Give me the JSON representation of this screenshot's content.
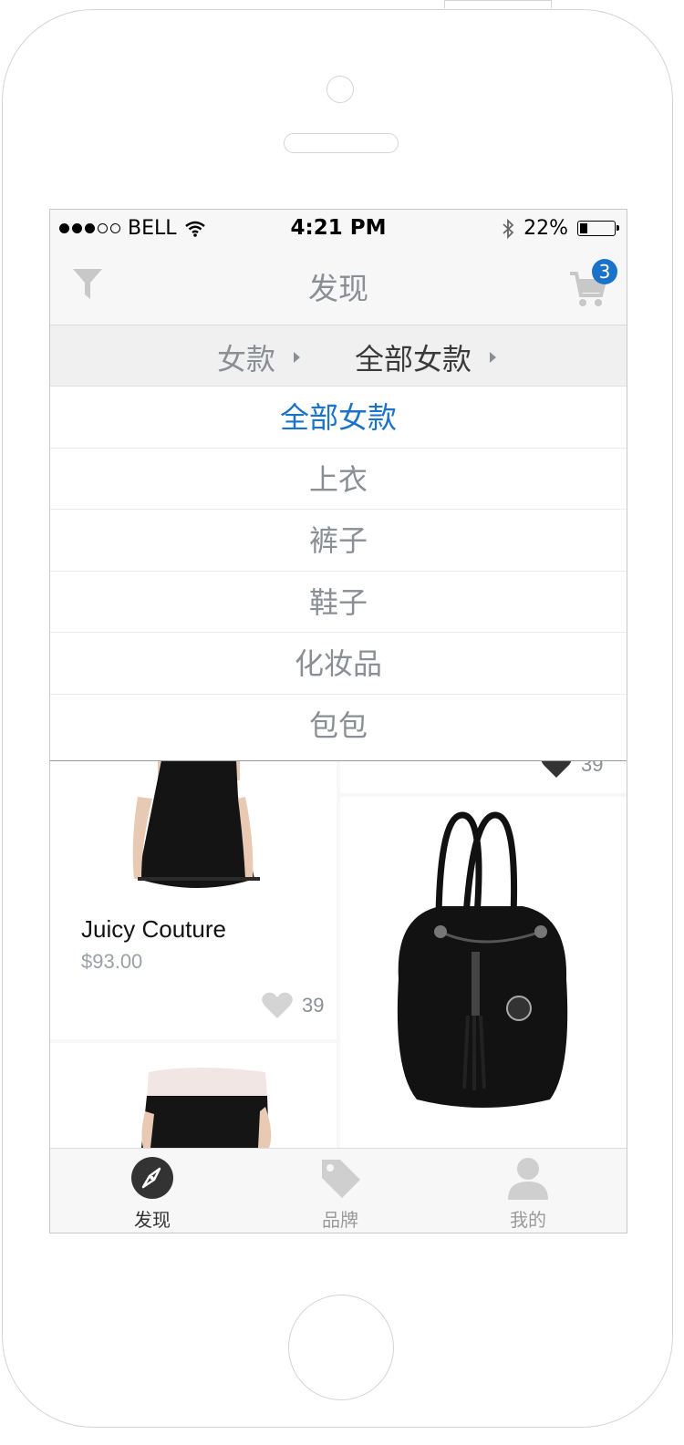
{
  "status_bar": {
    "carrier": "BELL",
    "time": "4:21 PM",
    "battery": "22%"
  },
  "nav": {
    "title": "发现",
    "cart_count": "3"
  },
  "breadcrumb": {
    "level1": "女款",
    "level2": "全部女款"
  },
  "dropdown": {
    "selected": "全部女款",
    "items": [
      "全部女款",
      "上衣",
      "裤子",
      "鞋子",
      "化妆品",
      "包包"
    ]
  },
  "products": [
    {
      "brand": "Juicy Couture",
      "price": "$93.00",
      "likes": "39",
      "image": "black-dress"
    },
    {
      "likes": "39",
      "image": "black-mk-handbag"
    },
    {
      "image": "black-jeans"
    }
  ],
  "tabbar": {
    "tabs": [
      {
        "label": "发现",
        "icon": "compass-icon",
        "active": true
      },
      {
        "label": "品牌",
        "icon": "tag-icon",
        "active": false
      },
      {
        "label": "我的",
        "icon": "user-icon",
        "active": false
      }
    ]
  },
  "colors": {
    "accent": "#1a73c9",
    "text_gray": "#8a8f96",
    "icon_gray": "#c8c8c8"
  }
}
